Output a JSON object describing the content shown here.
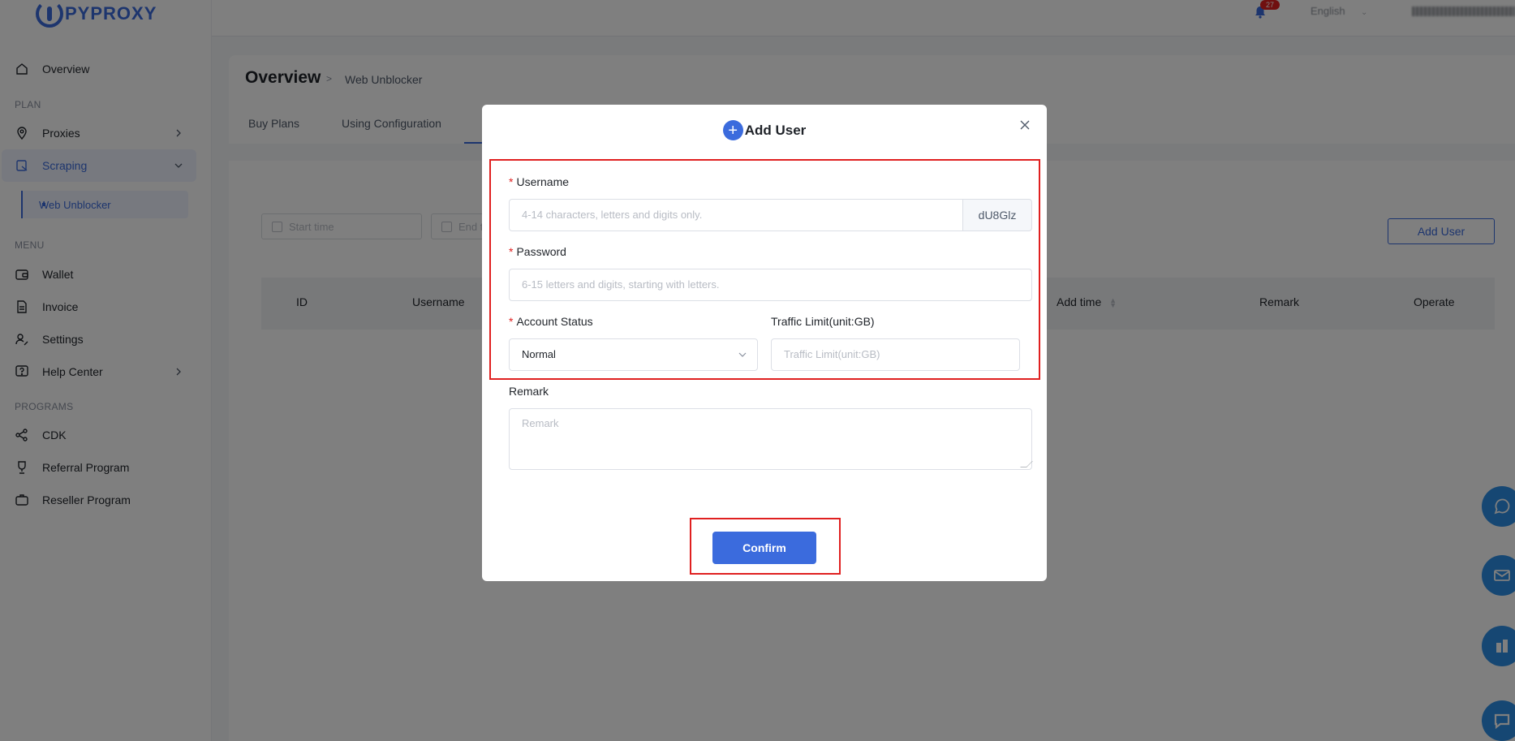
{
  "logo": {
    "text": "PYPROXY"
  },
  "sidebar": {
    "overview": "Overview",
    "section_plan": "PLAN",
    "proxies": "Proxies",
    "scraping": "Scraping",
    "web_unblocker": "Web Unblocker",
    "section_menu": "MENU",
    "wallet": "Wallet",
    "invoice": "Invoice",
    "settings": "Settings",
    "help_center": "Help Center",
    "section_programs": "PROGRAMS",
    "cdk": "CDK",
    "referral": "Referral Program",
    "reseller": "Reseller Program"
  },
  "header": {
    "notification_count": "27",
    "language": "English"
  },
  "page": {
    "breadcrumb_title": "Overview",
    "breadcrumb_sep": ">",
    "breadcrumb_sub": "Web Unblocker",
    "tabs": [
      "Buy Plans",
      "Using Configuration"
    ],
    "start_time_placeholder": "Start time",
    "end_time_placeholder": "End ti",
    "add_user_button": "Add User",
    "table_headers": {
      "id": "ID",
      "username": "Username",
      "add_time": "Add time",
      "remark": "Remark",
      "operate": "Operate"
    }
  },
  "modal": {
    "title": "Add User",
    "username_label": "Username",
    "username_placeholder": "4-14 characters, letters and digits only.",
    "username_suffix": "dU8Glz",
    "password_label": "Password",
    "password_placeholder": "6-15 letters and digits, starting with letters.",
    "status_label": "Account Status",
    "status_value": "Normal",
    "traffic_label": "Traffic Limit(unit:GB)",
    "traffic_placeholder": "Traffic Limit(unit:GB)",
    "remark_label": "Remark",
    "remark_placeholder": "Remark",
    "required_mark": "*",
    "confirm_button": "Confirm"
  },
  "colors": {
    "accent": "#3b6bdd",
    "highlight": "#e02020",
    "float_button": "#2d8fe6"
  }
}
